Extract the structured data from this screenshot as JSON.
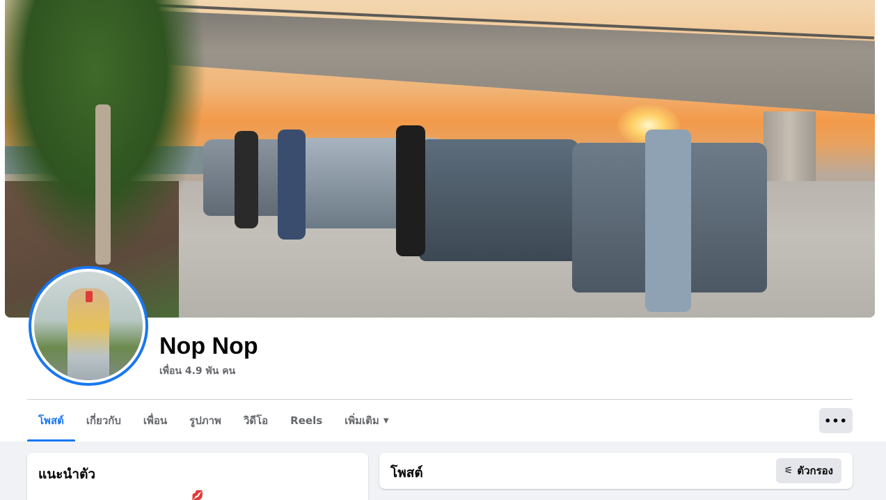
{
  "profile": {
    "name": "Nop Nop",
    "friends_text": "เพื่อน 4.9 พัน คน"
  },
  "tabs": [
    {
      "label": "โพสต์",
      "active": true
    },
    {
      "label": "เกี่ยวกับ",
      "active": false
    },
    {
      "label": "เพื่อน",
      "active": false
    },
    {
      "label": "รูปภาพ",
      "active": false
    },
    {
      "label": "วิดีโอ",
      "active": false
    },
    {
      "label": "Reels",
      "active": false
    },
    {
      "label": "เพิ่มเติม",
      "active": false
    }
  ],
  "more_button": {
    "icon": "ellipsis-icon",
    "glyph": "•••"
  },
  "intro": {
    "title": "แนะนำตัว",
    "emoji": "💋"
  },
  "posts": {
    "title": "โพสต์",
    "filter_label": "ตัวกรอง",
    "filter_icon": "sliders-icon"
  },
  "colors": {
    "accent": "#1877f2",
    "muted": "#65676b",
    "background": "#f0f2f5"
  }
}
